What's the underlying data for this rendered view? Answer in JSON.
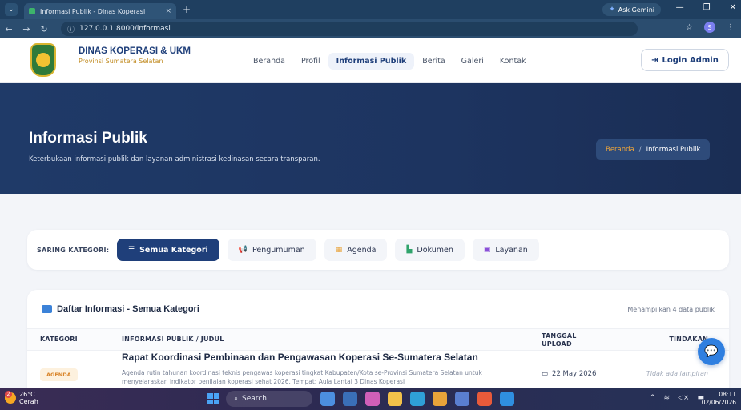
{
  "browser": {
    "tab_title": "Informasi Publik - Dinas Koperasi",
    "tab_close": "×",
    "new_tab": "+",
    "url": "127.0.0.1:8000/informasi",
    "gemini_label": "Ask Gemini",
    "profile_initial": "S"
  },
  "site": {
    "brand_name": "DINAS KOPERASI & UKM",
    "brand_sub": "Provinsi Sumatera Selatan",
    "nav": [
      {
        "label": "Beranda"
      },
      {
        "label": "Profil"
      },
      {
        "label": "Informasi Publik",
        "active": true
      },
      {
        "label": "Berita"
      },
      {
        "label": "Galeri"
      },
      {
        "label": "Kontak"
      }
    ],
    "login_label": "Login Admin",
    "login_icon": "login-arrow-icon"
  },
  "hero": {
    "title": "Informasi Publik",
    "subtitle": "Keterbukaan informasi publik dan layanan administrasi kedinasan secara transparan.",
    "breadcrumb": {
      "home": "Beranda",
      "separator": "/",
      "current": "Informasi Publik"
    }
  },
  "filter": {
    "label": "SARING KATEGORI:",
    "chips": [
      {
        "label": "Semua Kategori",
        "icon": "list-icon",
        "active": true
      },
      {
        "label": "Pengumuman",
        "icon": "megaphone-icon"
      },
      {
        "label": "Agenda",
        "icon": "calendar-icon"
      },
      {
        "label": "Dokumen",
        "icon": "document-icon"
      },
      {
        "label": "Layanan",
        "icon": "briefcase-icon"
      }
    ]
  },
  "list": {
    "title": "Daftar Informasi - Semua Kategori",
    "count_text": "Menampilkan 4 data publik",
    "columns": {
      "category": "KATEGORI",
      "title": "INFORMASI PUBLIK / JUDUL",
      "date_line1": "TANGGAL",
      "date_line2": "UPLOAD",
      "action": "TINDAKAN"
    },
    "rows": [
      {
        "badge": "AGENDA",
        "title": "Rapat Koordinasi Pembinaan dan Pengawasan Koperasi Se-Sumatera Selatan",
        "description": "Agenda rutin tahunan koordinasi teknis pengawas koperasi tingkat Kabupaten/Kota se-Provinsi Sumatera Selatan untuk menyelaraskan indikator penilaian koperasi sehat 2026. Tempat: Aula Lantai 3 Dinas Koperasi",
        "date": "22 May 2026",
        "action": "Tidak ada lampiran"
      }
    ]
  },
  "taskbar": {
    "weather_badge": "2",
    "temperature": "26°C",
    "condition": "Cerah",
    "search_label": "Search",
    "time": "08:11",
    "date": "02/06/2026"
  },
  "colors": {
    "primary": "#1f3f7a",
    "accent": "#f0a63a",
    "hero_bg": "#1d3460",
    "badge_agenda": "#d9852a"
  }
}
